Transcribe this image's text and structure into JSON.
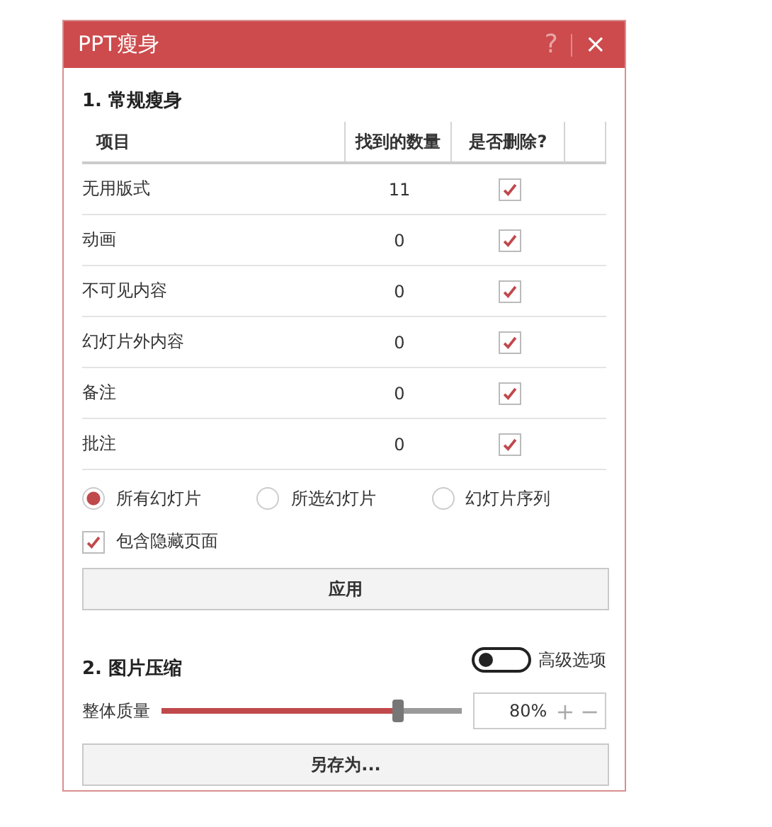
{
  "window": {
    "title": "PPT瘦身",
    "help": "?",
    "close": "×"
  },
  "section1": {
    "title": "1. 常规瘦身",
    "table": {
      "columns": [
        "项目",
        "找到的数量",
        "是否删除?"
      ],
      "rows": [
        {
          "item": "无用版式",
          "count": "11",
          "checked": true
        },
        {
          "item": "动画",
          "count": "0",
          "checked": true
        },
        {
          "item": "不可见内容",
          "count": "0",
          "checked": true
        },
        {
          "item": "幻灯片外内容",
          "count": "0",
          "checked": true
        },
        {
          "item": "备注",
          "count": "0",
          "checked": true
        },
        {
          "item": "批注",
          "count": "0",
          "checked": true
        }
      ]
    },
    "scope": [
      {
        "label": "所有幻灯片",
        "selected": true
      },
      {
        "label": "所选幻灯片",
        "selected": false
      },
      {
        "label": "幻灯片序列",
        "selected": false
      }
    ],
    "include_hidden": {
      "label": "包含隐藏页面",
      "checked": true
    },
    "apply_button": "应用"
  },
  "section2": {
    "title": "2. 图片压缩",
    "advanced": {
      "label": "高级选项",
      "on": false
    },
    "quality": {
      "label": "整体质量",
      "level": 0.79,
      "value": "80%",
      "plus": "+",
      "minus": "−"
    },
    "save_button": "另存为..."
  }
}
